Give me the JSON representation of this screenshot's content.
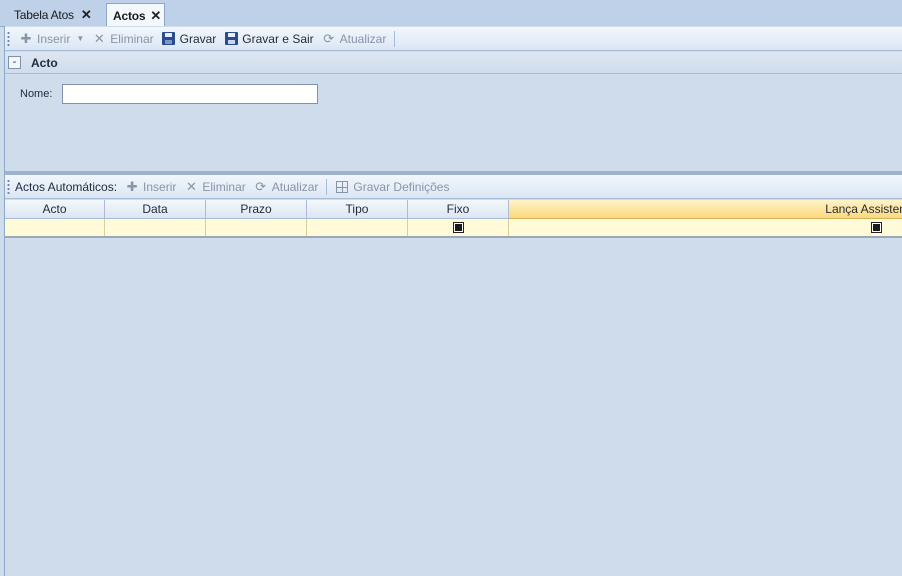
{
  "tabs": [
    {
      "label": "Tabela Atos",
      "active": false
    },
    {
      "label": "Actos",
      "active": true
    }
  ],
  "toolbar": {
    "insert_label": "Inserir",
    "delete_label": "Eliminar",
    "save_label": "Gravar",
    "save_exit_label": "Gravar e Sair",
    "refresh_label": "Atualizar"
  },
  "group": {
    "collapse_symbol": "-",
    "title": "Acto"
  },
  "form": {
    "name_label": "Nome:",
    "name_value": ""
  },
  "auto_toolbar": {
    "title": "Actos Automáticos:",
    "insert_label": "Inserir",
    "delete_label": "Eliminar",
    "refresh_label": "Atualizar",
    "save_settings_label": "Gravar Definições"
  },
  "grid": {
    "columns": [
      "Acto",
      "Data",
      "Prazo",
      "Tipo",
      "Fixo",
      "Lança Assistente"
    ],
    "rows": [
      {
        "acto": "",
        "data": "",
        "prazo": "",
        "tipo": "",
        "fixo": "indeterminate",
        "lanca_assistente": "indeterminate"
      }
    ]
  },
  "colors": {
    "background": "#cfdcec",
    "active_header": "#fbd87c",
    "new_row": "#fffbd9"
  }
}
